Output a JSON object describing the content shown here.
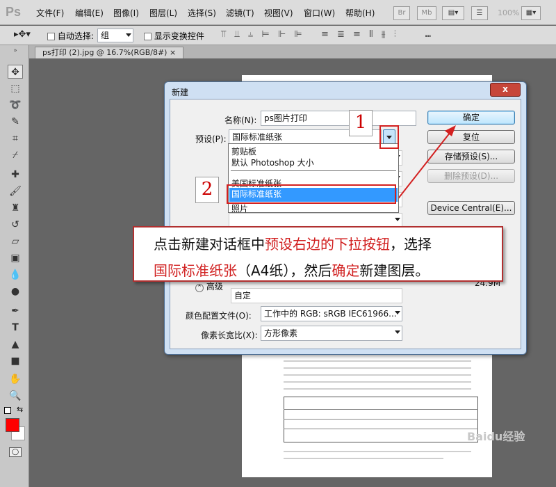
{
  "app": {
    "logo": "Ps"
  },
  "menu": [
    "文件(F)",
    "编辑(E)",
    "图像(I)",
    "图层(L)",
    "选择(S)",
    "滤镜(T)",
    "视图(V)",
    "窗口(W)",
    "帮助(H)"
  ],
  "topbar": {
    "br": "Br",
    "mb": "Mb",
    "zoom": "100%"
  },
  "options": {
    "auto_select_label": "自动选择:",
    "group_value": "组",
    "show_transform_label": "显示变换控件"
  },
  "document_tab": {
    "title": "ps打印 (2).jpg @ 16.7%(RGB/8#)",
    "close": "×"
  },
  "dialog": {
    "title": "新建",
    "close": "x",
    "name_label": "名称(N):",
    "name_value": "ps图片打印",
    "preset_label": "预设(P):",
    "preset_value": "国际标准纸张",
    "advanced_label": "高级",
    "profile_label": "颜色配置文件(O):",
    "profile_value": "工作中的 RGB: sRGB IEC61966...",
    "aspect_label": "像素长宽比(X):",
    "aspect_value": "方形像素",
    "custom_value": "自定",
    "image_size_value": "24.9M",
    "buttons": {
      "ok": "确定",
      "reset": "复位",
      "save_preset": "存储预设(S)...",
      "delete_preset": "删除预设(D)...",
      "device_central": "Device Central(E)..."
    },
    "dropdown_items": [
      "剪贴板",
      "默认 Photoshop 大小",
      "美国标准纸张",
      "国际标准纸张",
      "照片"
    ]
  },
  "annotations": {
    "marker1": "1",
    "marker2": "2",
    "callout_line1_a": "点击新建对话框中",
    "callout_line1_b": "预设右边的下拉按钮",
    "callout_line1_c": "，选择",
    "callout_line2_a": "国际标准纸张",
    "callout_line2_b": "（A4纸）",
    "callout_line2_c": "，然后",
    "callout_line2_d": "确定",
    "callout_line2_e": "新建图层。"
  },
  "watermark": "Baidu经验"
}
